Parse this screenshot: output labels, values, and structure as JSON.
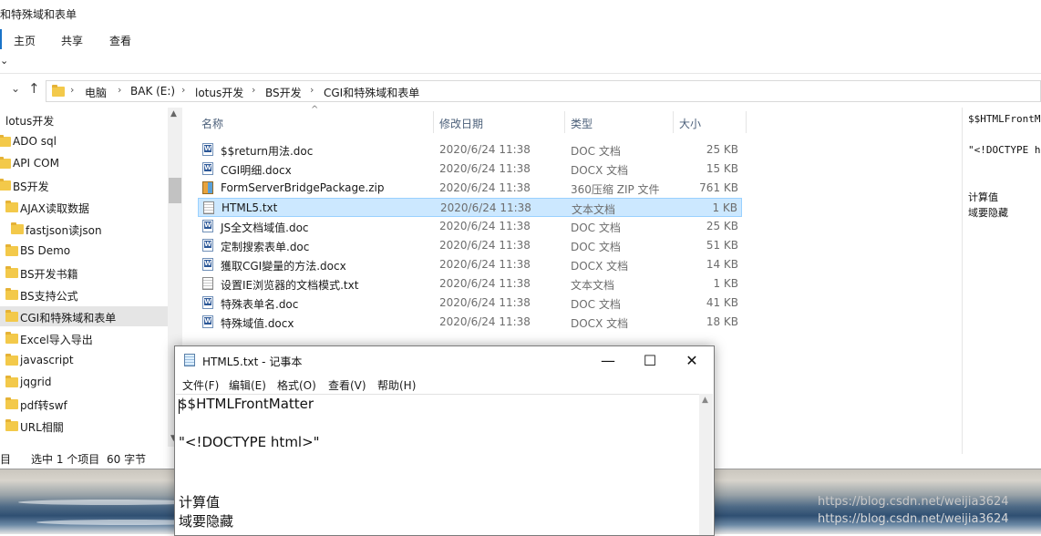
{
  "explorer": {
    "title": "和特殊域和表单",
    "ribbon_tabs": [
      "主页",
      "共享",
      "查看"
    ],
    "breadcrumb": [
      "电脑",
      "BAK (E:)",
      "lotus开发",
      "BS开发",
      "CGI和特殊域和表单"
    ],
    "nav_items": [
      {
        "label": "lotus开发",
        "indent": 0,
        "folder": false
      },
      {
        "label": "ADO sql",
        "indent": 1,
        "folder": true
      },
      {
        "label": "API COM",
        "indent": 1,
        "folder": true
      },
      {
        "label": "BS开发",
        "indent": 1,
        "folder": true
      },
      {
        "label": "AJAX读取数据",
        "indent": 2,
        "folder": true
      },
      {
        "label": "fastjson读json",
        "indent": 3,
        "folder": true
      },
      {
        "label": "BS Demo",
        "indent": 2,
        "folder": true
      },
      {
        "label": "BS开发书籍",
        "indent": 2,
        "folder": true
      },
      {
        "label": "BS支持公式",
        "indent": 2,
        "folder": true
      },
      {
        "label": "CGI和特殊域和表单",
        "indent": 2,
        "folder": true,
        "selected": true
      },
      {
        "label": "Excel导入导出",
        "indent": 2,
        "folder": true
      },
      {
        "label": "javascript",
        "indent": 2,
        "folder": true
      },
      {
        "label": "jqgrid",
        "indent": 2,
        "folder": true
      },
      {
        "label": "pdf转swf",
        "indent": 2,
        "folder": true
      },
      {
        "label": "URL相關",
        "indent": 2,
        "folder": true
      }
    ],
    "columns": {
      "name": "名称",
      "date": "修改日期",
      "type": "类型",
      "size": "大小"
    },
    "files": [
      {
        "name": "$$return用法.doc",
        "date": "2020/6/24 11:38",
        "type": "DOC 文档",
        "size": "25 KB",
        "icon": "doc"
      },
      {
        "name": "CGI明细.docx",
        "date": "2020/6/24 11:38",
        "type": "DOCX 文档",
        "size": "15 KB",
        "icon": "doc"
      },
      {
        "name": "FormServerBridgePackage.zip",
        "date": "2020/6/24 11:38",
        "type": "360压缩 ZIP 文件",
        "size": "761 KB",
        "icon": "zip"
      },
      {
        "name": "HTML5.txt",
        "date": "2020/6/24 11:38",
        "type": "文本文档",
        "size": "1 KB",
        "icon": "txt",
        "selected": true
      },
      {
        "name": "JS全文档域值.doc",
        "date": "2020/6/24 11:38",
        "type": "DOC 文档",
        "size": "25 KB",
        "icon": "doc"
      },
      {
        "name": "定制搜索表单.doc",
        "date": "2020/6/24 11:38",
        "type": "DOC 文档",
        "size": "51 KB",
        "icon": "doc"
      },
      {
        "name": "獲取CGI變量的方法.docx",
        "date": "2020/6/24 11:38",
        "type": "DOCX 文档",
        "size": "14 KB",
        "icon": "doc"
      },
      {
        "name": "设置IE浏览器的文档模式.txt",
        "date": "2020/6/24 11:38",
        "type": "文本文档",
        "size": "1 KB",
        "icon": "txt"
      },
      {
        "name": "特殊表单名.doc",
        "date": "2020/6/24 11:38",
        "type": "DOC 文档",
        "size": "41 KB",
        "icon": "doc"
      },
      {
        "name": "特殊域值.docx",
        "date": "2020/6/24 11:38",
        "type": "DOCX 文档",
        "size": "18 KB",
        "icon": "doc"
      }
    ],
    "preview_lines": [
      "$$HTMLFrontM",
      "\"<!DOCTYPE h",
      "计算值",
      "域要隐藏"
    ],
    "status": {
      "items": "目",
      "selected": "选中 1 个项目",
      "size": "60 字节"
    }
  },
  "notepad": {
    "title": "HTML5.txt - 记事本",
    "menu": [
      "文件(F)",
      "编辑(E)",
      "格式(O)",
      "查看(V)",
      "帮助(H)"
    ],
    "lines": [
      "$$HTMLFrontMatter",
      "\"<!DOCTYPE html>\"",
      "计算值",
      "域要隐藏"
    ],
    "window_buttons": {
      "minimize": "—",
      "maximize": "☐",
      "close": "✕"
    }
  },
  "watermark": "https://blog.csdn.net/weijia3624",
  "colors": {
    "accent": "#1a73c8",
    "selection": "#cce8ff",
    "folder": "#f3c94a"
  }
}
